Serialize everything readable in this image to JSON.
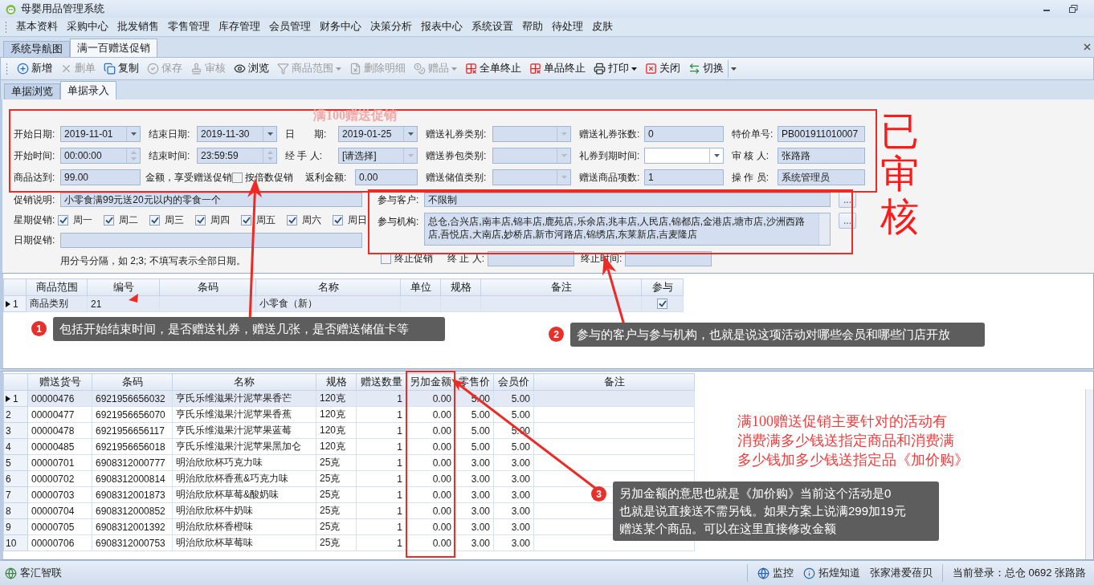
{
  "window": {
    "title": "母婴用品管理系统"
  },
  "menu": [
    "基本资料",
    "采购中心",
    "批发销售",
    "零售管理",
    "库存管理",
    "会员管理",
    "财务中心",
    "决策分析",
    "报表中心",
    "系统设置",
    "帮助",
    "待处理",
    "皮肤"
  ],
  "doc_tabs": [
    {
      "label": "系统导航图",
      "selected": false
    },
    {
      "label": "满一百赠送促销",
      "selected": true
    }
  ],
  "toolbar": [
    {
      "label": "新增",
      "kind": "add",
      "disabled": false
    },
    {
      "label": "删单",
      "kind": "delete",
      "disabled": true
    },
    {
      "label": "复制",
      "kind": "copy",
      "disabled": false
    },
    {
      "label": "保存",
      "kind": "save",
      "disabled": true
    },
    {
      "label": "审核",
      "kind": "audit",
      "disabled": true
    },
    {
      "label": "浏览",
      "kind": "view",
      "disabled": false
    },
    {
      "label": "商品范围",
      "kind": "filter",
      "disabled": true,
      "dropdown": true
    },
    {
      "label": "删除明细",
      "kind": "remove",
      "disabled": true
    },
    {
      "label": "赠品",
      "kind": "gift",
      "disabled": true,
      "dropdown": true
    },
    {
      "label": "全单终止",
      "kind": "stop_all",
      "disabled": false
    },
    {
      "label": "单品终止",
      "kind": "stop_item",
      "disabled": false
    },
    {
      "label": "打印",
      "kind": "print",
      "disabled": false,
      "dropdown": true
    },
    {
      "label": "关闭",
      "kind": "close",
      "disabled": false
    },
    {
      "label": "切换",
      "kind": "switch",
      "disabled": false
    }
  ],
  "sub_tabs": [
    {
      "label": "单据浏览",
      "selected": false
    },
    {
      "label": "单据录入",
      "selected": true
    }
  ],
  "form": {
    "rows": [
      [
        {
          "label": "开始日期:",
          "value": "2019-11-01",
          "kind": "date",
          "disabled": false
        },
        {
          "label": "结束日期:",
          "value": "2019-11-30",
          "kind": "date",
          "disabled": false
        },
        {
          "label": "日　　期:",
          "value": "2019-01-25",
          "kind": "date",
          "disabled": false
        },
        {
          "label": "赠送礼券类别:",
          "kind": "combo",
          "disabled": true
        },
        {
          "label": "赠送礼券张数:",
          "value": "0",
          "kind": "text"
        },
        {
          "label": "特价单号:",
          "value": "PB001911010007",
          "kind": "text"
        }
      ],
      [
        {
          "label": "开始时间:",
          "value": "00:00:00",
          "kind": "spin",
          "disabled": true
        },
        {
          "label": "结束时间:",
          "value": "23:59:59",
          "kind": "spin",
          "disabled": true
        },
        {
          "label": "经 手 人:",
          "value": "[请选择]",
          "kind": "combo",
          "disabled": true
        },
        {
          "label": "赠送券包类别:",
          "kind": "combo",
          "disabled": true
        },
        {
          "label": "礼券到期时间:",
          "kind": "date",
          "disabled": false
        },
        {
          "label": "审 核 人:",
          "value": "张路路",
          "kind": "text"
        }
      ],
      [
        {
          "label": "商品达到:",
          "value": "99.00",
          "kind": "text"
        },
        {
          "kind": "rule",
          "note": "金额，享受赠送促销",
          "checkbox": {
            "label": "按倍数促销",
            "checked": false
          }
        },
        {
          "kind": "amount",
          "label": "返利金额:",
          "value": "0.00"
        },
        {
          "label": "赠送储值类别:",
          "kind": "combo",
          "disabled": true
        },
        {
          "label": "赠送商品项数:",
          "value": "1",
          "kind": "text"
        },
        {
          "label": "操 作 员:",
          "value": "系统管理员",
          "kind": "text"
        }
      ]
    ]
  },
  "promo": {
    "description": {
      "label": "促销说明:",
      "value": "小零食满99元送20元以内的零食一个"
    },
    "weekdays": {
      "label": "星期促销:",
      "days": [
        {
          "label": "周一",
          "checked": true
        },
        {
          "label": "周二",
          "checked": true
        },
        {
          "label": "周三",
          "checked": true
        },
        {
          "label": "周四",
          "checked": true
        },
        {
          "label": "周五",
          "checked": true
        },
        {
          "label": "周六",
          "checked": true
        },
        {
          "label": "周日",
          "checked": true
        }
      ]
    },
    "dates": {
      "label": "日期促销:",
      "hint": "用分号分隔，如 2;3; 不填写表示全部日期。"
    }
  },
  "participants": {
    "customers": {
      "label": "参与客户:",
      "value": "不限制",
      "button": "..."
    },
    "orgs": {
      "label": "参与机构:",
      "value": "总仓,合兴店,南丰店,锦丰店,鹿苑店,乐余店,兆丰店,人民店,锦都店,金港店,塘市店,沙洲西路店,吾悦店,大南店,妙桥店,新市河路店,锦绣店,东莱新店,吉麦隆店",
      "button": "..."
    },
    "stop": {
      "label": "终止促销",
      "checked": false,
      "stopper_label": "终 止 人:",
      "time_label": "终止时间:"
    }
  },
  "upper_grid": {
    "columns": [
      "商品范围",
      "编号",
      "条码",
      "名称",
      "单位",
      "规格",
      "备注",
      "参与"
    ],
    "rows": [
      {
        "number": "1",
        "selected": true,
        "range": "商品类别",
        "code": "21",
        "name": "小零食（新）",
        "joined": true
      }
    ]
  },
  "lower_grid": {
    "columns": [
      "赠送货号",
      "条码",
      "名称",
      "规格",
      "赠送数量",
      "另加金额",
      "零售价",
      "会员价",
      "备注"
    ],
    "rows": [
      {
        "number": "1",
        "selected": true,
        "cells": [
          "00000476",
          "6921956656032",
          "亨氏乐维滋果汁泥苹果香芒",
          "120克",
          "1",
          "0.00",
          "5.00",
          "5.00"
        ]
      },
      {
        "number": "2",
        "selected": false,
        "cells": [
          "00000477",
          "6921956656070",
          "亨氏乐维滋果汁泥苹果香蕉",
          "120克",
          "1",
          "0.00",
          "5.00",
          "5.00"
        ]
      },
      {
        "number": "3",
        "selected": false,
        "cells": [
          "00000478",
          "6921956656117",
          "亨氏乐维滋果汁泥苹果蓝莓",
          "120克",
          "1",
          "0.00",
          "5.00",
          "5.00"
        ]
      },
      {
        "number": "4",
        "selected": false,
        "cells": [
          "00000485",
          "6921956656018",
          "亨氏乐维滋果汁泥苹果黑加仑",
          "120克",
          "1",
          "0.00",
          "5.00",
          "5.00"
        ]
      },
      {
        "number": "5",
        "selected": false,
        "cells": [
          "00000701",
          "6908312000777",
          "明治欣欣杯巧克力味",
          "25克",
          "1",
          "0.00",
          "3.00",
          "3.00"
        ]
      },
      {
        "number": "6",
        "selected": false,
        "cells": [
          "00000702",
          "6908312000814",
          "明治欣欣杯香蕉&巧克力味",
          "25克",
          "1",
          "0.00",
          "3.00",
          "3.00"
        ]
      },
      {
        "number": "7",
        "selected": false,
        "cells": [
          "00000703",
          "6908312001873",
          "明治欣欣杯草莓&酸奶味",
          "25克",
          "1",
          "0.00",
          "3.00",
          "3.00"
        ]
      },
      {
        "number": "8",
        "selected": false,
        "cells": [
          "00000704",
          "6908312000852",
          "明治欣欣杯牛奶味",
          "25克",
          "1",
          "0.00",
          "3.00",
          "3.00"
        ]
      },
      {
        "number": "9",
        "selected": false,
        "cells": [
          "00000705",
          "6908312001392",
          "明治欣欣杯香橙味",
          "25克",
          "1",
          "0.00",
          "3.00",
          "3.00"
        ]
      },
      {
        "number": "10",
        "selected": false,
        "cells": [
          "00000706",
          "6908312000753",
          "明治欣欣杯草莓味",
          "25克",
          "1",
          "0.00",
          "3.00",
          "3.00"
        ]
      }
    ]
  },
  "annotations": {
    "title_note": "满100赠送促销",
    "stamp": "已审核",
    "callouts": [
      {
        "number": "1",
        "lines": [
          "包括开始结束时间，是否赠送礼券，赠送几张，是否赠送储值卡等"
        ]
      },
      {
        "number": "2",
        "lines": [
          "参与的客户与参与机构，也就是说这项活动对哪些会员和哪些门店开放"
        ]
      },
      {
        "number": "3",
        "lines": [
          "另加金额的意思也就是《加价购》当前这个活动是0",
          "也就是说直接送不需另钱。如果方案上说满299加19元",
          "赠送某个商品。可以在这里直接修改金额"
        ]
      }
    ],
    "note_lines": [
      "满100赠送促销主要针对的活动有",
      "消费满多少钱送指定商品和消费满",
      "多少钱加多少钱送指定品《加价购》"
    ]
  },
  "status_bar": {
    "left": "客汇智联",
    "items": [
      {
        "label": "监控",
        "kind": "monitor"
      },
      {
        "label": "拓煌知道",
        "kind": "info"
      }
    ],
    "company": "张家港爱蓓贝",
    "login": "当前登录：总仓 0692 张路路"
  }
}
